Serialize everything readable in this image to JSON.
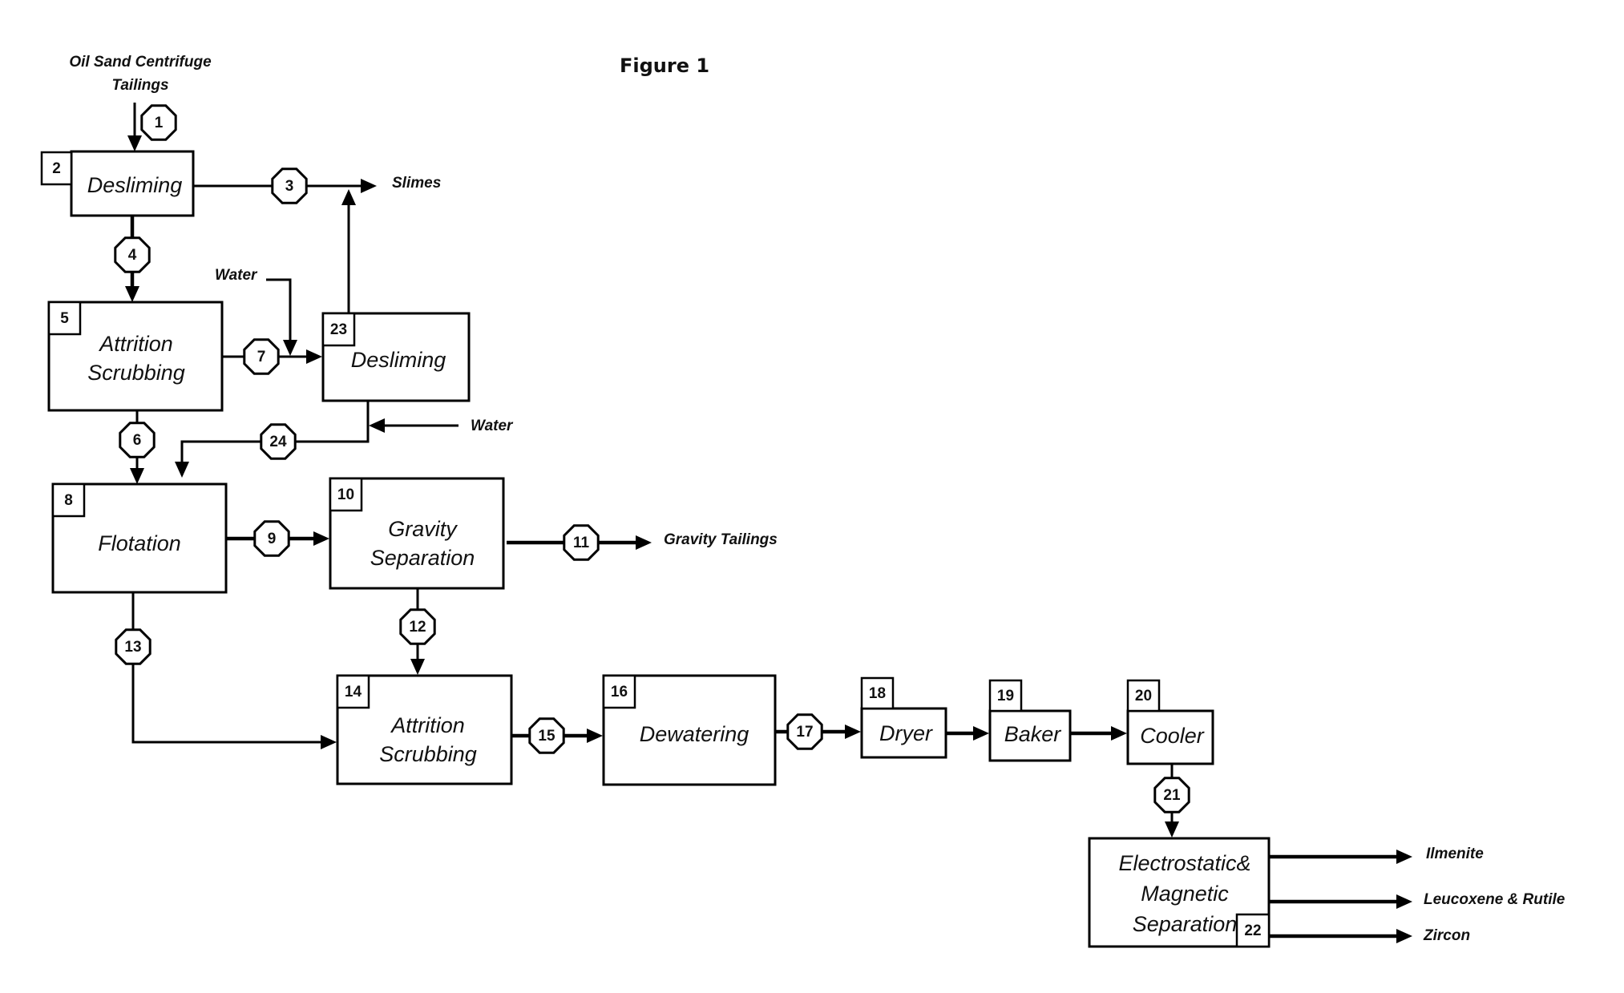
{
  "figure": {
    "title": "Figure 1",
    "feed_label_line1": "Oil Sand Centrifuge",
    "feed_label_line2": "Tailings"
  },
  "units": [
    {
      "id": "2",
      "lines": [
        "Desliming"
      ]
    },
    {
      "id": "5",
      "lines": [
        "Attrition",
        "Scrubbing"
      ]
    },
    {
      "id": "23",
      "lines": [
        "Desliming"
      ]
    },
    {
      "id": "8",
      "lines": [
        "Flotation"
      ]
    },
    {
      "id": "10",
      "lines": [
        "Gravity",
        "Separation"
      ]
    },
    {
      "id": "14",
      "lines": [
        "Attrition",
        "Scrubbing"
      ]
    },
    {
      "id": "16",
      "lines": [
        "Dewatering"
      ]
    },
    {
      "id": "18",
      "lines": [
        "Dryer"
      ]
    },
    {
      "id": "19",
      "lines": [
        "Baker"
      ]
    },
    {
      "id": "20",
      "lines": [
        "Cooler"
      ]
    },
    {
      "id": "22",
      "lines": [
        "Electrostatic&",
        "Magnetic",
        "Separation"
      ]
    }
  ],
  "streams": [
    "1",
    "3",
    "4",
    "6",
    "7",
    "9",
    "11",
    "12",
    "13",
    "15",
    "17",
    "21",
    "24"
  ],
  "external_labels": {
    "slimes": "Slimes",
    "water_top": "Water",
    "water_bottom": "Water",
    "gravity_tailings": "Gravity Tailings",
    "ilmenite": "Ilmenite",
    "leucoxene_rutile": "Leucoxene & Rutile",
    "zircon": "Zircon"
  },
  "colors": {
    "ink": "#000000",
    "background": "#ffffff"
  }
}
